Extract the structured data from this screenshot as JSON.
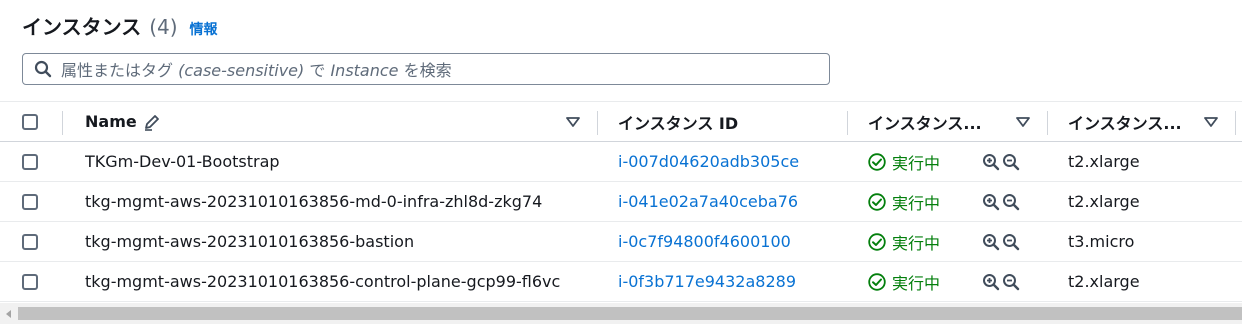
{
  "header": {
    "title": "インスタンス",
    "count": "(4)",
    "info": "情報"
  },
  "search": {
    "prefix": "属性またはタグ ",
    "italic1": "(case-sensitive)",
    "mid": " で ",
    "italic2": "Instance",
    "suffix": " を検索"
  },
  "columns": {
    "name": "Name",
    "instance_id": "インスタンス ID",
    "state": "インスタンス...",
    "type": "インスタンス..."
  },
  "rows": [
    {
      "name": "TKGm-Dev-01-Bootstrap",
      "id": "i-007d04620adb305ce",
      "state": "実行中",
      "type": "t2.xlarge"
    },
    {
      "name": "tkg-mgmt-aws-20231010163856-md-0-infra-zhl8d-zkg74",
      "id": "i-041e02a7a40ceba76",
      "state": "実行中",
      "type": "t2.xlarge"
    },
    {
      "name": "tkg-mgmt-aws-20231010163856-bastion",
      "id": "i-0c7f94800f4600100",
      "state": "実行中",
      "type": "t3.micro"
    },
    {
      "name": "tkg-mgmt-aws-20231010163856-control-plane-gcp99-fl6vc",
      "id": "i-0f3b717e9432a8289",
      "state": "実行中",
      "type": "t2.xlarge"
    }
  ],
  "icons": {
    "edit": "pencil-icon",
    "sort": "caret-down-icon",
    "state": "check-circle-icon",
    "zoom_in": "zoom-in-icon",
    "zoom_out": "zoom-out-icon",
    "search": "search-icon"
  },
  "colors": {
    "link": "#0972d3",
    "success": "#037f0c",
    "text": "#16191f",
    "muted": "#5f6b7a"
  }
}
